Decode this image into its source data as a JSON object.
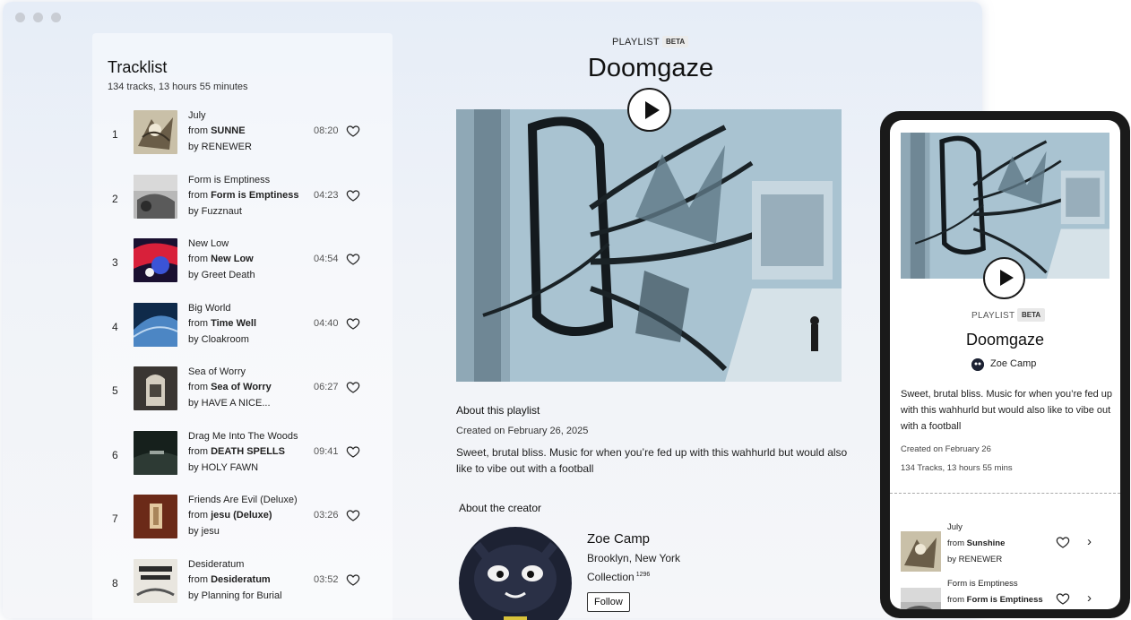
{
  "tracklist": {
    "title": "Tracklist",
    "summary": "134 tracks, 13 hours 55 minutes",
    "tracks": [
      {
        "num": "1",
        "title": "July",
        "from_prefix": "from ",
        "album": "SUNNE",
        "artist": "by RENEWER",
        "duration": "08:20"
      },
      {
        "num": "2",
        "title": "Form is Emptiness",
        "from_prefix": "from ",
        "album": "Form is Emptiness",
        "artist": "by Fuzznaut",
        "duration": "04:23"
      },
      {
        "num": "3",
        "title": "New Low",
        "from_prefix": "from ",
        "album": "New Low",
        "artist": "by Greet Death",
        "duration": "04:54"
      },
      {
        "num": "4",
        "title": "Big World",
        "from_prefix": "from ",
        "album": "Time Well",
        "artist": "by Cloakroom",
        "duration": "04:40"
      },
      {
        "num": "5",
        "title": "Sea of Worry",
        "from_prefix": "from ",
        "album": "Sea of Worry",
        "artist": "by HAVE A NICE...",
        "duration": "06:27"
      },
      {
        "num": "6",
        "title": "Drag Me Into The Woods",
        "from_prefix": "from ",
        "album": "DEATH SPELLS",
        "artist": "by HOLY FAWN",
        "duration": "09:41"
      },
      {
        "num": "7",
        "title": "Friends Are Evil (Deluxe)",
        "from_prefix": "from ",
        "album": "jesu (Deluxe)",
        "artist": "by jesu",
        "duration": "03:26"
      },
      {
        "num": "8",
        "title": "Desideratum",
        "from_prefix": "from ",
        "album": "Desideratum",
        "artist": "by Planning for Burial",
        "duration": "03:52"
      }
    ]
  },
  "playlist": {
    "label": "PLAYLIST",
    "badge": "BETA",
    "title": "Doomgaze",
    "about_heading": "About this playlist",
    "created": "Created on February 26, 2025",
    "description": "Sweet, brutal bliss. Music for when you’re fed up with this wahhurld but would also like to vibe out with a football"
  },
  "creator": {
    "heading": "About the creator",
    "name": "Zoe Camp",
    "location": "Brooklyn, New York",
    "collection_label": "Collection",
    "collection_count": "1296",
    "follow_label": "Follow"
  },
  "mobile": {
    "label": "PLAYLIST",
    "badge": "BETA",
    "title": "Doomgaze",
    "creator": "Zoe Camp",
    "description": "Sweet, brutal bliss. Music for when you’re fed up with this wahhurld but would also like to vibe out with a football",
    "created": "Created on February 26",
    "count": "134 Tracks, 13 hours 55 mins",
    "tracks": [
      {
        "title": "July",
        "from_prefix": "from ",
        "album": "Sunshine",
        "artist": "by RENEWER"
      },
      {
        "title": "Form is Emptiness",
        "from_prefix": "from ",
        "album": "Form is Emptiness",
        "artist": ""
      }
    ]
  },
  "colors": {
    "cover_bg": "#a7c1d0",
    "text": "#1c1c1c"
  }
}
